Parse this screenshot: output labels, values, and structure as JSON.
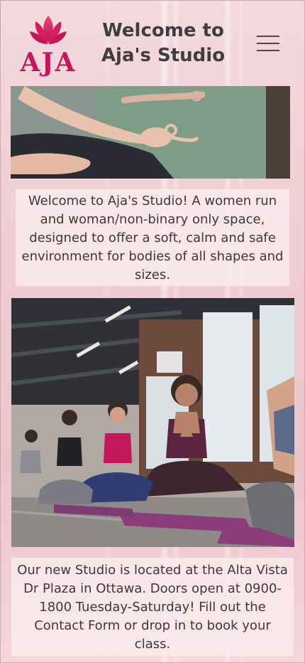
{
  "header": {
    "logo_text": "AJA",
    "title_line1": "Welcome to",
    "title_line2": "Aja's Studio",
    "menu_icon": "hamburger-menu-icon"
  },
  "hero_image": {
    "subject": "hands-in-meditation-mudra-photo"
  },
  "intro": {
    "text": "Welcome to Aja's Studio! A women run and woman/non-binary only space, designed to offer a soft, calm and safe environment for bodies of all shapes and sizes."
  },
  "class_image": {
    "subject": "yoga-class-prayer-pose-photo"
  },
  "location": {
    "text": "Our new Studio is located at the Alta Vista Dr Plaza in Ottawa. Doors open at 0900- 1800 Tuesday-Saturday! Fill out the Contact Form or drop in to book your class."
  },
  "colors": {
    "brand": "#c2185b",
    "lotus": "#e5336b",
    "background": "#f0cdd4",
    "text": "#3a3a3a"
  }
}
